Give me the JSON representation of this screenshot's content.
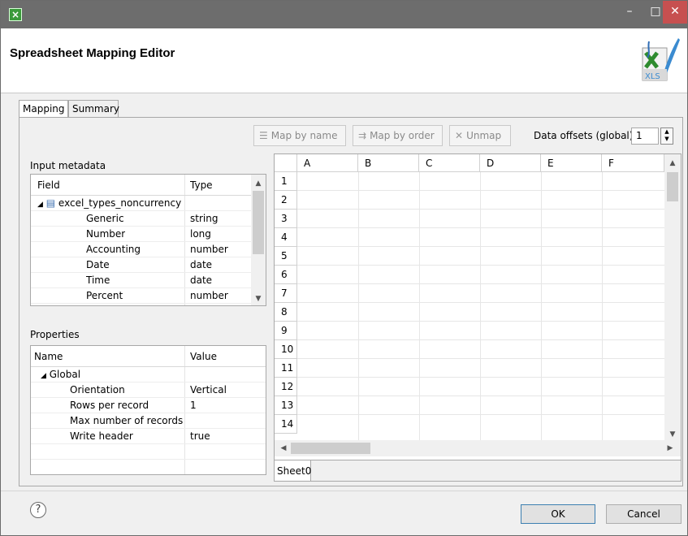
{
  "window": {
    "minimize": "–",
    "maximize": "□",
    "close": "✕"
  },
  "header": {
    "title": "Spreadsheet Mapping Editor",
    "logo_text": "XLS"
  },
  "tabs": [
    {
      "label": "Mapping",
      "active": true
    },
    {
      "label": "Summary",
      "active": false
    }
  ],
  "toolbar": {
    "map_by_name": "Map by name",
    "map_by_order": "Map by order",
    "unmap": "Unmap",
    "data_offsets_label": "Data offsets (global)",
    "data_offsets_value": "1"
  },
  "input_metadata": {
    "label": "Input metadata",
    "columns": [
      "Field",
      "Type"
    ],
    "record": "excel_types_noncurrency",
    "rows": [
      {
        "field": "Generic",
        "type": "string"
      },
      {
        "field": "Number",
        "type": "long"
      },
      {
        "field": "Accounting",
        "type": "number"
      },
      {
        "field": "Date",
        "type": "date"
      },
      {
        "field": "Time",
        "type": "date"
      },
      {
        "field": "Percent",
        "type": "number"
      }
    ]
  },
  "properties": {
    "label": "Properties",
    "columns": [
      "Name",
      "Value"
    ],
    "group": "Global",
    "rows": [
      {
        "name": "Orientation",
        "value": "Vertical"
      },
      {
        "name": "Rows per record",
        "value": "1"
      },
      {
        "name": "Max number of records",
        "value": ""
      },
      {
        "name": "Write header",
        "value": "true"
      }
    ]
  },
  "sheet": {
    "columns": [
      "A",
      "B",
      "C",
      "D",
      "E",
      "F"
    ],
    "rows": [
      "1",
      "2",
      "3",
      "4",
      "5",
      "6",
      "7",
      "8",
      "9",
      "10",
      "11",
      "12",
      "13",
      "14"
    ],
    "tab": "Sheet0"
  },
  "footer": {
    "help": "?",
    "ok": "OK",
    "cancel": "Cancel"
  }
}
